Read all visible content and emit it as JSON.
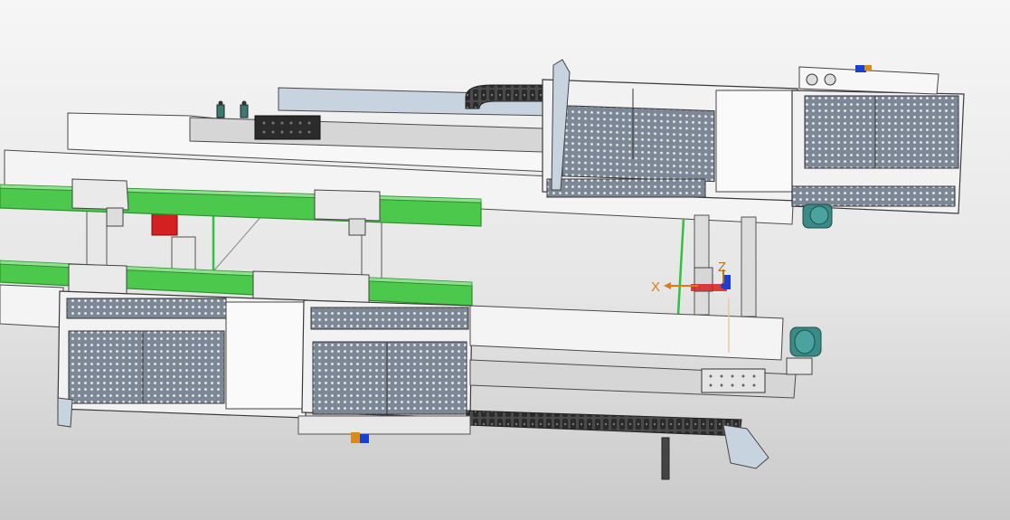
{
  "viewport": {
    "background_top": "#f6f6f6",
    "background_bottom": "#c9c9c9"
  },
  "triad": {
    "x_label": "X",
    "z_label": "Z",
    "x_color": "#e07a18",
    "y_color": "#1b3fd0",
    "z_color": "#c07010"
  },
  "colors": {
    "frame_fill": "#f4f4f4",
    "frame_stroke": "#4a4a4a",
    "belt_green": "#4cc94c",
    "belt_green_dark": "#2e8f2e",
    "perforated_panel": "#6a7585",
    "drag_chain": "#3a3a3a",
    "motor_teal": "#3a8a86",
    "red_part": "#d42020",
    "rail_blue": "#c8d3e0"
  }
}
